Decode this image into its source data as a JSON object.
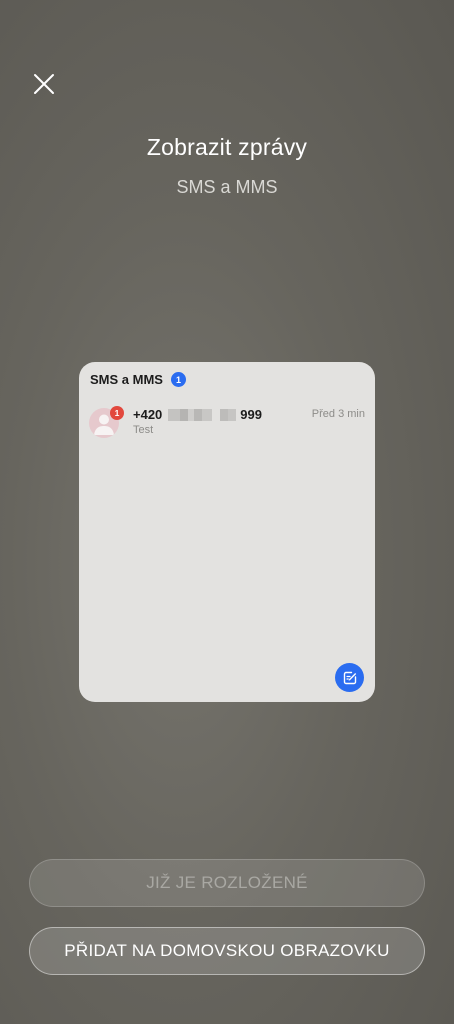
{
  "header": {
    "close_icon": "close-icon",
    "title": "Zobrazit zprávy",
    "subtitle": "SMS a MMS"
  },
  "widget": {
    "title": "SMS a MMS",
    "unread_count": "1",
    "message": {
      "sender_prefix": "+420",
      "sender_suffix": "999",
      "preview": "Test",
      "time": "Před 3 min",
      "badge": "1",
      "avatar_icon": "person-icon"
    },
    "compose_icon": "compose-icon"
  },
  "buttons": {
    "disabled_label": "JIŽ JE ROZLOŽENÉ",
    "add_label": "PŘIDAT NA DOMOVSKOU OBRAZOVKU"
  },
  "colors": {
    "accent": "#2a6cf0",
    "badge_red": "#e2483d",
    "widget_bg": "#e3e2e0"
  }
}
